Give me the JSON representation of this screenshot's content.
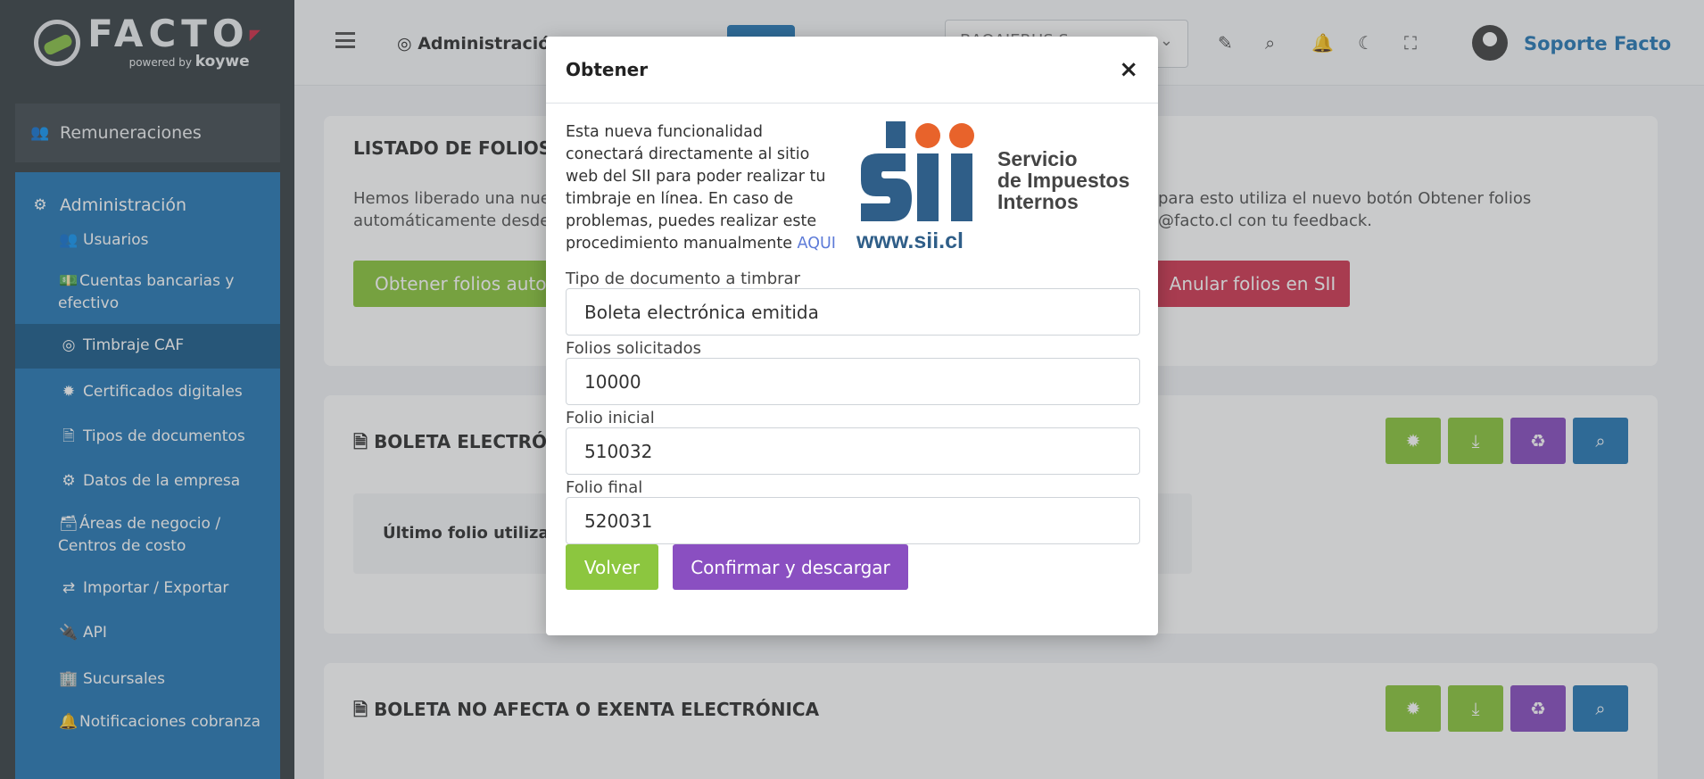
{
  "brand": {
    "name": "FACTO",
    "powered": "powered by",
    "koywe": "koywe"
  },
  "sidebar": {
    "remuneraciones": "Remuneraciones",
    "admin_label": "Administración",
    "items": [
      {
        "label": "Usuarios",
        "icon": "users-icon"
      },
      {
        "label": "Cuentas bancarias y efectivo",
        "icon": "money-icon"
      },
      {
        "label": "Timbraje CAF",
        "icon": "target-icon"
      },
      {
        "label": "Certificados digitales",
        "icon": "certificate-icon"
      },
      {
        "label": "Tipos de documentos",
        "icon": "document-icon"
      },
      {
        "label": "Datos de la empresa",
        "icon": "gear-icon"
      },
      {
        "label": "Áreas de negocio / Centros de costo",
        "icon": "archive-icon"
      },
      {
        "label": "Importar / Exportar",
        "icon": "exchange-icon"
      },
      {
        "label": "API",
        "icon": "plug-icon"
      },
      {
        "label": "Sucursales",
        "icon": "building-icon"
      },
      {
        "label": "Notificaciones cobranza",
        "icon": "bell-icon"
      }
    ]
  },
  "topbar": {
    "breadcrumb": "Administración",
    "company_select": "BAQAJERUS S",
    "user_name": "Soporte Facto"
  },
  "main": {
    "listado_title": "LISTADO DE FOLIOS",
    "listado_text_left_1": "Hemos liberado una nue",
    "listado_text_left_2": "automáticamente desde",
    "listado_text_right_1": "para esto utiliza el nuevo botón Obtener folios",
    "listado_text_right_2": "@facto.cl con tu feedback.",
    "obtener_button": "Obtener folios autom",
    "anular_button": "Anular folios en SII",
    "boleta_title": "BOLETA ELECTRÓNI",
    "ultimo_folio": "Último folio utilizad",
    "boleta_exenta_title": "BOLETA NO AFECTA O EXENTA ELECTRÓNICA"
  },
  "modal": {
    "title": "Obtener",
    "close": "×",
    "intro": "Esta nueva funcionalidad conectará directamente al sitio web del SII para poder realizar tu timbraje en línea. En caso de problemas, puedes realizar este procedimiento manualmente",
    "link": "AQUI",
    "sii_logo_text_1": "Servicio",
    "sii_logo_text_2": "de Impuestos",
    "sii_logo_text_3": "Internos",
    "sii_url": "www.sii.cl",
    "fields": [
      {
        "label": "Tipo de documento a timbrar",
        "value": "Boleta electrónica emitida"
      },
      {
        "label": "Folios solicitados",
        "value": "10000"
      },
      {
        "label": "Folio inicial",
        "value": "510032"
      },
      {
        "label": "Folio final",
        "value": "520031"
      }
    ],
    "back_button": "Volver",
    "confirm_button": "Confirmar y descargar"
  },
  "colors": {
    "sidebar_bg": "#3c4449",
    "admin_blue": "#2a7bb6",
    "green": "#8cc63f",
    "purple": "#8a4fc1",
    "red": "#d23b55"
  }
}
